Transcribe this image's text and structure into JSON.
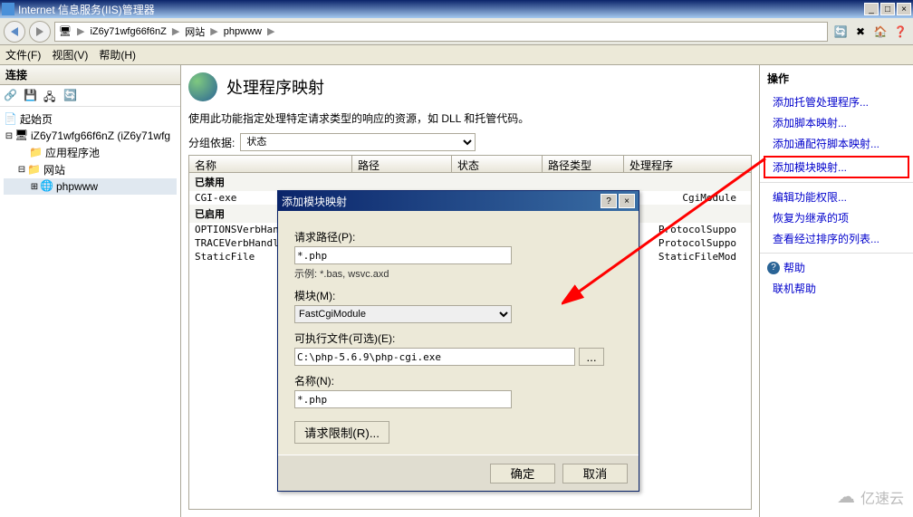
{
  "titlebar": {
    "text": "Internet 信息服务(IIS)管理器"
  },
  "breadcrumb": {
    "server": "iZ6y71wfg66f6nZ",
    "site": "网站",
    "app": "phpwww"
  },
  "menu": {
    "file": "文件(F)",
    "view": "视图(V)",
    "help": "帮助(H)"
  },
  "left": {
    "header": "连接",
    "tree": {
      "start": "起始页",
      "server": "iZ6y71wfg66f6nZ (iZ6y71wfg",
      "apppool": "应用程序池",
      "sites": "网站",
      "phpwww": "phpwww"
    }
  },
  "center": {
    "title": "处理程序映射",
    "desc": "使用此功能指定处理特定请求类型的响应的资源，如 DLL 和托管代码。",
    "groupby_label": "分组依据:",
    "groupby_value": "状态",
    "cols": {
      "name": "名称",
      "path": "路径",
      "status": "状态",
      "pathtype": "路径类型",
      "handler": "处理程序"
    },
    "sections": {
      "disabled": "已禁用",
      "enabled": "已启用"
    },
    "rows": {
      "cgi": {
        "name": "CGI-exe",
        "handler": "CgiModule"
      },
      "options": {
        "name": "OPTIONSVerbHandl",
        "handler": "ProtocolSuppo"
      },
      "trace": {
        "name": "TRACEVerbHandle",
        "handler": "ProtocolSuppo"
      },
      "static": {
        "name": "StaticFile",
        "handler": "StaticFileMod"
      }
    }
  },
  "right": {
    "header": "操作",
    "links": {
      "managed": "添加托管处理程序...",
      "script": "添加脚本映射...",
      "wildcard": "添加通配符脚本映射...",
      "module": "添加模块映射...",
      "feature": "编辑功能权限...",
      "revert": "恢复为继承的项",
      "ordered": "查看经过排序的列表..."
    },
    "help": "帮助",
    "onlinehelp": "联机帮助"
  },
  "dialog": {
    "title": "添加模块映射",
    "reqpath_label": "请求路径(P):",
    "reqpath_value": "*.php",
    "example": "示例: *.bas, wsvc.axd",
    "module_label": "模块(M):",
    "module_value": "FastCgiModule",
    "exe_label": "可执行文件(可选)(E):",
    "exe_value": "C:\\php-5.6.9\\php-cgi.exe",
    "name_label": "名称(N):",
    "name_value": "*.php",
    "browse": "...",
    "restrictions": "请求限制(R)...",
    "ok": "确定",
    "cancel": "取消"
  },
  "watermark": "亿速云"
}
